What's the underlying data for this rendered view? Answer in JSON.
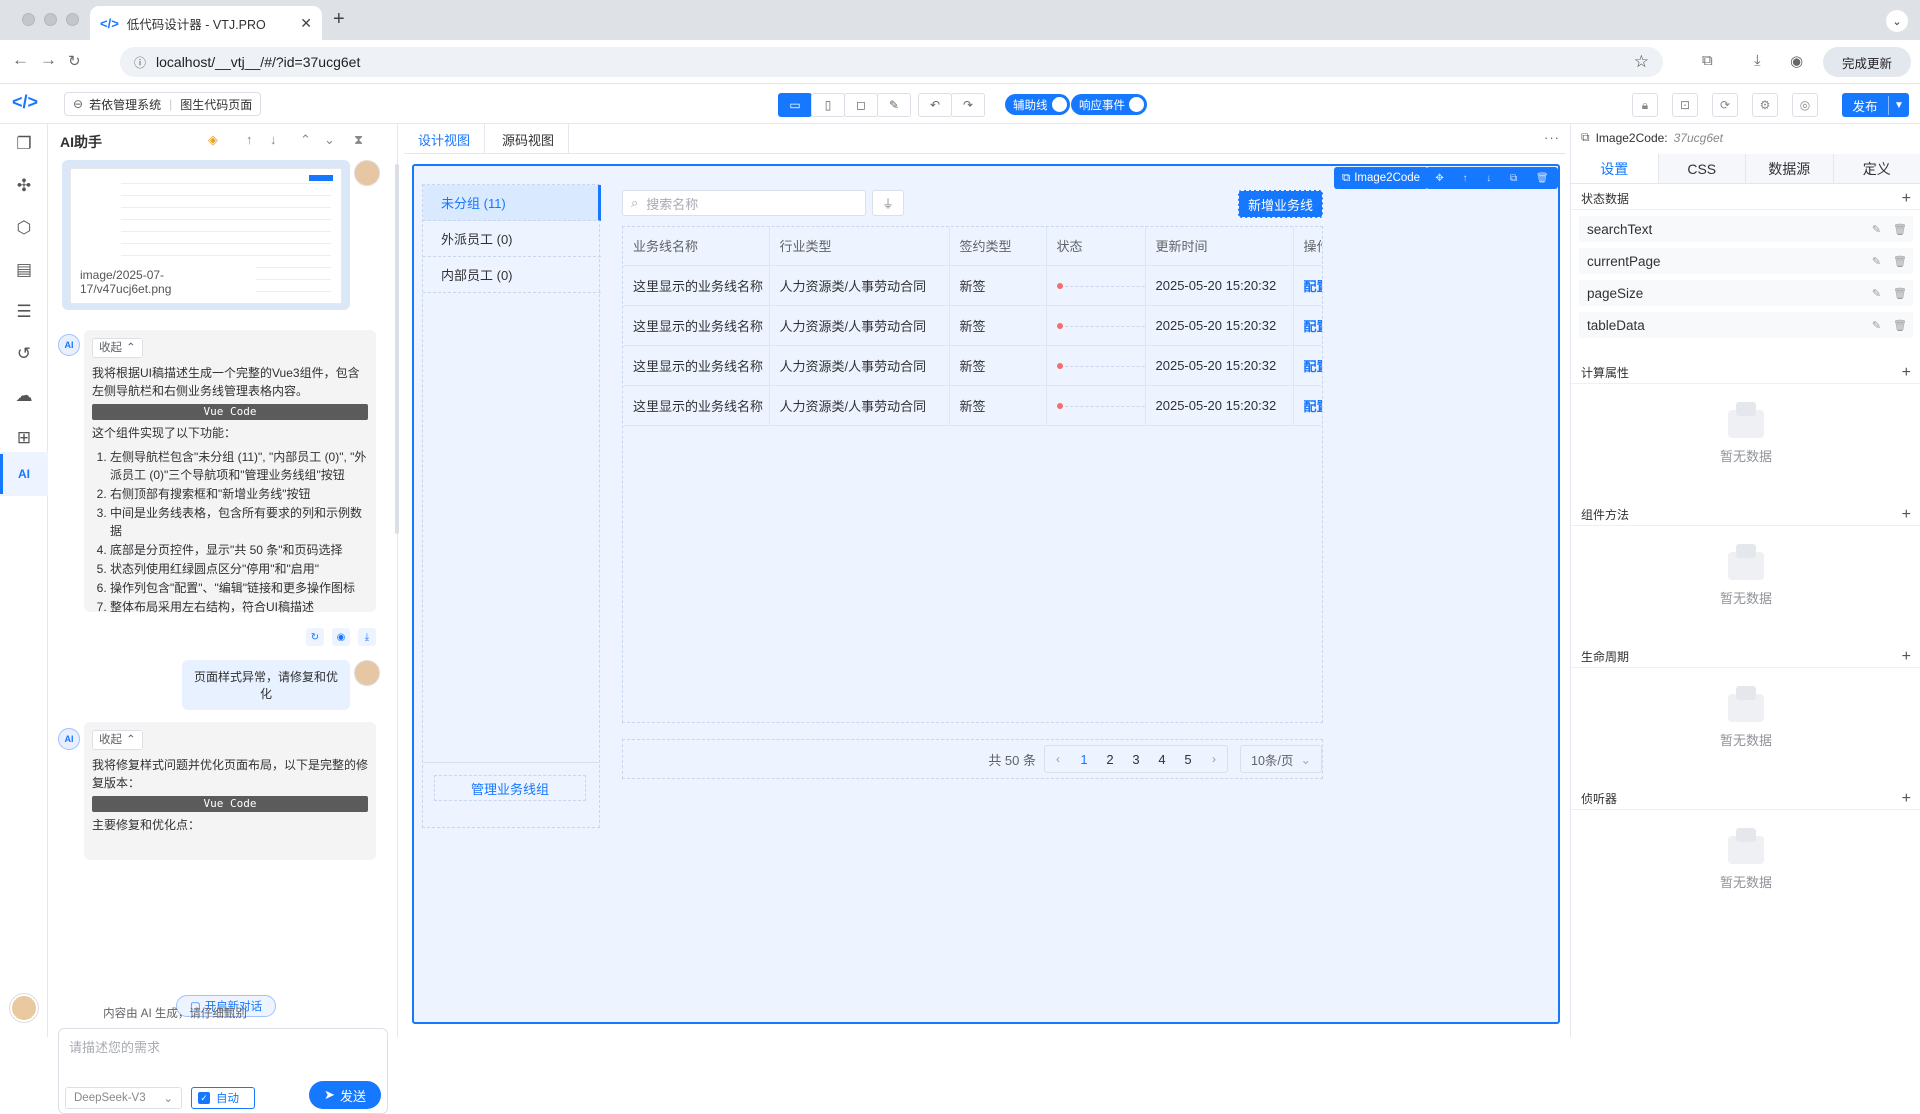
{
  "browser": {
    "tab_title": "低代码设计器 - VTJ.PRO",
    "url": "localhost/__vtj__/#/?id=37ucg6et",
    "update_button": "完成更新"
  },
  "toolbar": {
    "breadcrumb_project": "若依管理系统",
    "breadcrumb_page": "图生代码页面",
    "toggle_guides": "辅助线",
    "toggle_events": "响应事件",
    "publish": "发布"
  },
  "ai_panel": {
    "title": "AI助手",
    "image_caption": "image/2025-07-17/v47ucj6et.png",
    "collapse_label": "收起",
    "msg1_intro": "我将根据UI稿描述生成一个完整的Vue3组件，包含左侧导航栏和右侧业务线管理表格内容。",
    "vue_code_label": "Vue Code",
    "msg1_features_title": "这个组件实现了以下功能：",
    "msg1_features": [
      "左侧导航栏包含\"未分组 (11)\", \"内部员工 (0)\", \"外派员工 (0)\"三个导航项和\"管理业务线组\"按钮",
      "右侧顶部有搜索框和\"新增业务线\"按钮",
      "中间是业务线表格，包含所有要求的列和示例数据",
      "底部是分页控件，显示\"共 50 条\"和页码选择",
      "状态列使用红绿圆点区分\"停用\"和\"启用\"",
      "操作列包含\"配置\"、\"编辑\"链接和更多操作图标",
      "整体布局采用左右结构，符合UI稿描述"
    ],
    "user_msg2": "页面样式异常，请修复和优化",
    "msg2_intro": "我将修复样式问题并优化页面布局，以下是完整的修复版本：",
    "msg2_tail": "主要修复和优化点：",
    "new_chat": "开启新对话",
    "input_placeholder": "请描述您的需求",
    "model": "DeepSeek-V3",
    "auto_label": "自动",
    "send": "发送",
    "footer": "内容由 AI 生成，请仔细甄别"
  },
  "center": {
    "tab_design": "设计视图",
    "tab_source": "源码视图",
    "badge": "Image2Code",
    "nav_items": [
      "未分组 (11)",
      "外派员工 (0)",
      "内部员工 (0)"
    ],
    "manage_button": "管理业务线组",
    "search_placeholder": "搜索名称",
    "add_button": "新增业务线",
    "table_headers": [
      "业务线名称",
      "行业类型",
      "签约类型",
      "状态",
      "更新时间",
      "操作"
    ],
    "rows": [
      {
        "name": "这里显示的业务线名称",
        "industry": "人力资源类/人事劳动合同",
        "sign": "新签",
        "time": "2025-05-20 15:20:32",
        "action": "配置"
      },
      {
        "name": "这里显示的业务线名称",
        "industry": "人力资源类/人事劳动合同",
        "sign": "新签",
        "time": "2025-05-20 15:20:32",
        "action": "配置"
      },
      {
        "name": "这里显示的业务线名称",
        "industry": "人力资源类/人事劳动合同",
        "sign": "新签",
        "time": "2025-05-20 15:20:32",
        "action": "配置"
      },
      {
        "name": "这里显示的业务线名称",
        "industry": "人力资源类/人事劳动合同",
        "sign": "新签",
        "time": "2025-05-20 15:20:32",
        "action": "配置"
      }
    ],
    "pager_total": "共 50 条",
    "pages": [
      "1",
      "2",
      "3",
      "4",
      "5"
    ],
    "page_size": "10条/页"
  },
  "right_panel": {
    "component_name": "Image2Code:",
    "component_id": "37ucg6et",
    "tabs": [
      "设置",
      "CSS",
      "数据源",
      "定义"
    ],
    "state_title": "状态数据",
    "state_items": [
      "searchText",
      "currentPage",
      "pageSize",
      "tableData"
    ],
    "computed_title": "计算属性",
    "methods_title": "组件方法",
    "lifecycle_title": "生命周期",
    "watchers_title": "侦听器",
    "empty_text": "暂无数据"
  },
  "colors": {
    "primary": "#1677ff",
    "status_red": "#f56c6c"
  }
}
